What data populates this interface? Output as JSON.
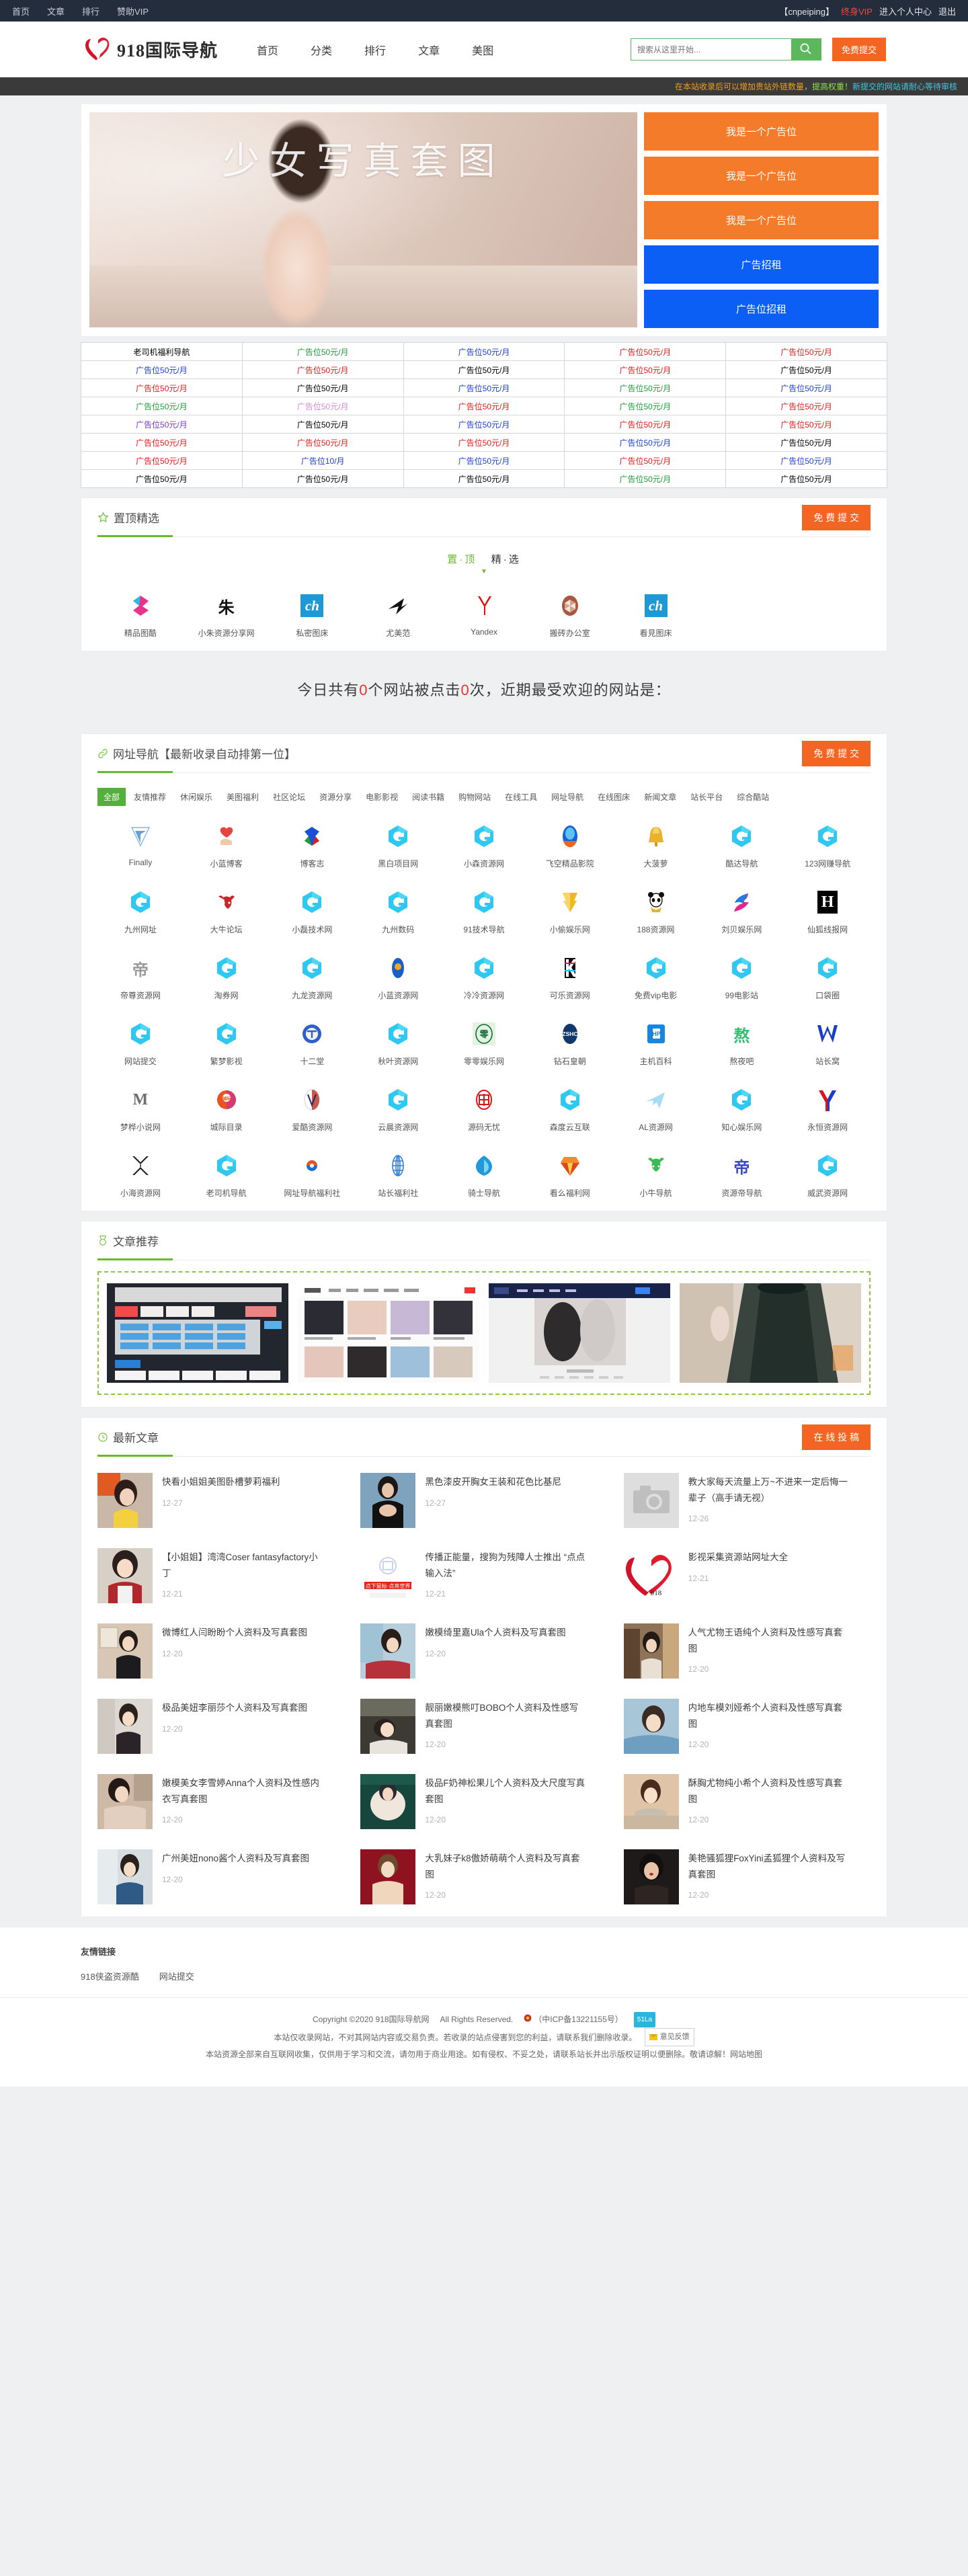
{
  "topbar": {
    "left_links": [
      "首页",
      "文章",
      "排行",
      "赞助VIP"
    ],
    "username": "【cnpeiping】",
    "vip_label": "终身VIP",
    "center_label": "进入个人中心",
    "logout_label": "退出"
  },
  "header": {
    "logo_text": "918国际导航",
    "nav": [
      "首页",
      "分类",
      "排行",
      "文章",
      "美图"
    ],
    "search_placeholder": "搜索从这里开始...",
    "search_value": "",
    "search_icon": "search-icon",
    "submit_label": "免费提交"
  },
  "notice": {
    "part1": "在本站收录后可以增加贵站外链数量",
    "part2": "，提高权重！",
    "part3": "新提交的网站请耐心等待审核"
  },
  "hero": {
    "overlay_text": "少女写真套图",
    "ads": [
      {
        "label": "我是一个广告位",
        "color": "#f47b2a"
      },
      {
        "label": "我是一个广告位",
        "color": "#f47b2a"
      },
      {
        "label": "我是一个广告位",
        "color": "#f47b2a"
      },
      {
        "label": "广告招租",
        "color": "#0b5ff5"
      },
      {
        "label": "广告位招租",
        "color": "#0b5ff5"
      }
    ]
  },
  "ad_table": {
    "rows": [
      [
        {
          "t": "老司机福利导航",
          "c": "#000000"
        },
        {
          "t": "广告位50元/月",
          "c": "#1f9d3a"
        },
        {
          "t": "广告位50元/月",
          "c": "#1b3fd4"
        },
        {
          "t": "广告位50元/月",
          "c": "#e21b1b"
        },
        {
          "t": "广告位50元/月",
          "c": "#e21b1b"
        }
      ],
      [
        {
          "t": "广告位50元/月",
          "c": "#1b3fd4"
        },
        {
          "t": "广告位50元/月",
          "c": "#e21b1b"
        },
        {
          "t": "广告位50元/月",
          "c": "#000000"
        },
        {
          "t": "广告位50元/月",
          "c": "#e21b1b"
        },
        {
          "t": "广告位50元/月",
          "c": "#000000"
        }
      ],
      [
        {
          "t": "广告位50元/月",
          "c": "#e21b1b"
        },
        {
          "t": "广告位50元/月",
          "c": "#000000"
        },
        {
          "t": "广告位50元/月",
          "c": "#1b3fd4"
        },
        {
          "t": "广告位50元/月",
          "c": "#1f9d3a"
        },
        {
          "t": "广告位50元/月",
          "c": "#1b3fd4"
        }
      ],
      [
        {
          "t": "广告位50元/月",
          "c": "#1f9d3a"
        },
        {
          "t": "广告位50元/月",
          "c": "#d58ad5"
        },
        {
          "t": "广告位50元/月",
          "c": "#e21b1b"
        },
        {
          "t": "广告位50元/月",
          "c": "#1f9d3a"
        },
        {
          "t": "广告位50元/月",
          "c": "#e21b1b"
        }
      ],
      [
        {
          "t": "广告位50元/月",
          "c": "#7a36c9"
        },
        {
          "t": "广告位50元/月",
          "c": "#000000"
        },
        {
          "t": "广告位50元/月",
          "c": "#1b3fd4"
        },
        {
          "t": "广告位50元/月",
          "c": "#e21b1b"
        },
        {
          "t": "广告位50元/月",
          "c": "#e21b1b"
        }
      ],
      [
        {
          "t": "广告位50元/月",
          "c": "#e21b1b"
        },
        {
          "t": "广告位50元/月",
          "c": "#e21b1b"
        },
        {
          "t": "广告位50元/月",
          "c": "#e21b1b"
        },
        {
          "t": "广告位50元/月",
          "c": "#1b3fd4"
        },
        {
          "t": "广告位50元/月",
          "c": "#000000"
        }
      ],
      [
        {
          "t": "广告位50元/月",
          "c": "#e21b1b"
        },
        {
          "t": "广告位10/月",
          "c": "#1b3fd4"
        },
        {
          "t": "广告位50元/月",
          "c": "#1b3fd4"
        },
        {
          "t": "广告位50元/月",
          "c": "#e21b1b"
        },
        {
          "t": "广告位50元/月",
          "c": "#1b3fd4"
        }
      ],
      [
        {
          "t": "广告位50元/月",
          "c": "#000000"
        },
        {
          "t": "广告位50元/月",
          "c": "#000000"
        },
        {
          "t": "广告位50元/月",
          "c": "#000000"
        },
        {
          "t": "广告位50元/月",
          "c": "#1f9d3a"
        },
        {
          "t": "广告位50元/月",
          "c": "#000000"
        }
      ]
    ]
  },
  "top_selection": {
    "title": "置顶精选",
    "icon": "star-icon",
    "submit_label": "免 费 提 交",
    "divider_top": "置·顶",
    "divider_fine": "精·选",
    "items": [
      {
        "name": "精品图酷",
        "logo": "pink-s-icon"
      },
      {
        "name": "小朱资源分享网",
        "logo": "zhu-char-icon"
      },
      {
        "name": "私密图床",
        "logo": "ch-blue-icon"
      },
      {
        "name": "尤美范",
        "logo": "black-swoosh-icon"
      },
      {
        "name": "Yandex",
        "logo": "yandex-y-icon"
      },
      {
        "name": "搬砖办公室",
        "logo": "brown-cube-icon"
      },
      {
        "name": "看見图床",
        "logo": "ch-blue-icon"
      }
    ]
  },
  "stats": {
    "prefix": "今日共有",
    "site_count": "0",
    "middle": "个网站被点击",
    "click_count": "0",
    "suffix": "次，近期最受欢迎的网站是："
  },
  "nav_section": {
    "title": "网址导航【最新收录自动排第一位】",
    "icon": "link-icon",
    "submit_label": "免 费 提 交",
    "categories": [
      "全部",
      "友情推荐",
      "休闲娱乐",
      "美图福利",
      "社区论坛",
      "资源分享",
      "电影影视",
      "阅读书籍",
      "购物网站",
      "在线工具",
      "网址导航",
      "在线图床",
      "新闻文章",
      "站长平台",
      "综合酷站"
    ],
    "active_category": "全部",
    "sites": [
      {
        "name": "Finally",
        "logo": "triangle-f-icon"
      },
      {
        "name": "小蓝博客",
        "logo": "heart-hand-icon"
      },
      {
        "name": "博客志",
        "logo": "multicolor-s-icon"
      },
      {
        "name": "黑白项目网",
        "logo": "g-cyan-icon"
      },
      {
        "name": "小森资源网",
        "logo": "g-cyan-icon"
      },
      {
        "name": "飞空精品影院",
        "logo": "blue-orb-icon"
      },
      {
        "name": "大菠萝",
        "logo": "gold-bell-icon"
      },
      {
        "name": "酷达导航",
        "logo": "g-cyan-icon"
      },
      {
        "name": "123网赚导航",
        "logo": "g-cyan-icon"
      },
      {
        "name": "九州网址",
        "logo": "g-cyan-icon"
      },
      {
        "name": "大牛论坛",
        "logo": "red-bull-icon"
      },
      {
        "name": "小磊技术网",
        "logo": "g-cyan-icon"
      },
      {
        "name": "九州数码",
        "logo": "g-cyan-icon"
      },
      {
        "name": "91技术导航",
        "logo": "g-cyan-icon"
      },
      {
        "name": "小偷娱乐网",
        "logo": "gold-arrow-icon"
      },
      {
        "name": "188资源网",
        "logo": "panda-icon"
      },
      {
        "name": "刘贝娱乐网",
        "logo": "pink-swirl-icon"
      },
      {
        "name": "仙狐线报网",
        "logo": "black-h-icon"
      },
      {
        "name": "帝尊资源网",
        "logo": "di-char-icon"
      },
      {
        "name": "淘券网",
        "logo": "g-cyan-icon"
      },
      {
        "name": "九龙资源网",
        "logo": "g-cyan-icon"
      },
      {
        "name": "小蓝资源网",
        "logo": "blue-dot-icon"
      },
      {
        "name": "冷冷资源网",
        "logo": "g-cyan-icon"
      },
      {
        "name": "可乐资源网",
        "logo": "k-glitch-icon"
      },
      {
        "name": "免费vip电影",
        "logo": "g-cyan-icon"
      },
      {
        "name": "99电影站",
        "logo": "g-cyan-icon"
      },
      {
        "name": "口袋圈",
        "logo": "g-cyan-icon"
      },
      {
        "name": "网站提交",
        "logo": "g-cyan-icon"
      },
      {
        "name": "繁梦影视",
        "logo": "g-cyan-icon"
      },
      {
        "name": "十二堂",
        "logo": "blue-circle-t-icon"
      },
      {
        "name": "秋叶资源网",
        "logo": "g-cyan-icon"
      },
      {
        "name": "零零娱乐网",
        "logo": "ling-circle-icon"
      },
      {
        "name": "钻石皇朝",
        "logo": "zshc-oval-icon"
      },
      {
        "name": "主机百科",
        "logo": "blue-square-icon"
      },
      {
        "name": "熬夜吧",
        "logo": "ao-green-icon"
      },
      {
        "name": "站长窝",
        "logo": "blue-w-icon"
      },
      {
        "name": "梦桦小说网",
        "logo": "m-serif-icon"
      },
      {
        "name": "城际目录",
        "logo": "orange-circle-icon"
      },
      {
        "name": "爱酷资源网",
        "logo": "v-oval-icon"
      },
      {
        "name": "云晨资源网",
        "logo": "g-cyan-icon"
      },
      {
        "name": "源码无忧",
        "logo": "red-oval-icon"
      },
      {
        "name": "森度云互联",
        "logo": "g-cyan-icon"
      },
      {
        "name": "AL资源网",
        "logo": "plane-icon"
      },
      {
        "name": "知心娱乐网",
        "logo": "g-cyan-icon"
      },
      {
        "name": "永恒资源网",
        "logo": "red-blue-y-icon"
      },
      {
        "name": "小海资源网",
        "logo": "x-outline-icon"
      },
      {
        "name": "老司机导航",
        "logo": "g-cyan-icon"
      },
      {
        "name": "网址导航福利社",
        "logo": "small-orb-icon"
      },
      {
        "name": "站长福利社",
        "logo": "globe-blue-icon"
      },
      {
        "name": "骑士导航",
        "logo": "blue-leaf-icon"
      },
      {
        "name": "看么福利网",
        "logo": "red-diamond-icon"
      },
      {
        "name": "小牛导航",
        "logo": "green-bull-icon"
      },
      {
        "name": "资源帝导航",
        "logo": "di-blue-icon"
      },
      {
        "name": "威武资源网",
        "logo": "g-cyan-icon"
      }
    ]
  },
  "article_rec": {
    "title": "文章推荐",
    "icon": "medal-icon",
    "thumbs": [
      "rec-thumb-1",
      "rec-thumb-2",
      "rec-thumb-3",
      "rec-thumb-4"
    ]
  },
  "latest": {
    "title": "最新文章",
    "icon": "clock-icon",
    "submit_label": "在 线 投 稿",
    "articles": [
      {
        "title": "快看小姐姐美图卧槽萝莉福利",
        "date": "12-27",
        "thumb": "girl-yellow-top"
      },
      {
        "title": "黑色漆皮开胸女王装和花色比基尼",
        "date": "12-27",
        "thumb": "girl-black-latex"
      },
      {
        "title": "教大家每天流量上万~不进来一定后悔一辈子（高手请无视）",
        "date": "12-26",
        "thumb": "camera-placeholder"
      },
      {
        "title": "【小姐姐】湾湾Coser fantasyfactory小丁",
        "date": "12-21",
        "thumb": "coser-girl"
      },
      {
        "title": "传播正能量，搜狗为残障人士推出 “点点输入法”",
        "date": "12-21",
        "thumb": "sogou-banner"
      },
      {
        "title": "影视采集资源站网址大全",
        "date": "12-21",
        "thumb": "site-logo"
      },
      {
        "title": "微博红人闫盼盼个人资料及写真套图",
        "date": "12-20",
        "thumb": "yanpanpan"
      },
      {
        "title": "嫩模绮里嘉Ula个人资料及写真套图",
        "date": "12-20",
        "thumb": "qilijia"
      },
      {
        "title": "人气尤物王语纯个人资料及性感写真套图",
        "date": "12-20",
        "thumb": "wangyuchun"
      },
      {
        "title": "极品美妞李丽莎个人资料及写真套图",
        "date": "12-20",
        "thumb": "lilisha"
      },
      {
        "title": "靓丽嫩模熊叮BOBO个人资料及性感写真套图",
        "date": "12-20",
        "thumb": "bobo"
      },
      {
        "title": "内地车模刘娅希个人资料及性感写真套图",
        "date": "12-20",
        "thumb": "liuyaxi"
      },
      {
        "title": "嫩模美女李雪婷Anna个人资料及性感内衣写真套图",
        "date": "12-20",
        "thumb": "lixueting"
      },
      {
        "title": "极品F奶神松果儿个人资料及大尺度写真套图",
        "date": "12-20",
        "thumb": "songguoer"
      },
      {
        "title": "酥胸尤物纯小希个人资料及性感写真套图",
        "date": "12-20",
        "thumb": "chunxiaoxi"
      },
      {
        "title": "广州美妞nono酱个人资料及写真套图",
        "date": "12-20",
        "thumb": "nono"
      },
      {
        "title": "大乳妹子k8傲娇萌萌个人资料及写真套图",
        "date": "12-20",
        "thumb": "k8mengmeng"
      },
      {
        "title": "美艳骚狐狸FoxYini孟狐狸个人资料及写真套图",
        "date": "12-20",
        "thumb": "foxyini"
      }
    ]
  },
  "friend_links": {
    "title": "友情链接",
    "links": [
      "918侠盗资源酷",
      "网站提交"
    ]
  },
  "footer": {
    "copyright": "Copyright ©2020 918国际导航网",
    "rights": "All Rights Reserved.",
    "icp": "（中ICP备13221155号）",
    "la_badge": "51La",
    "line2": "本站仅收录网站，不对其网站内容或交易负责。若收录的站点侵害到您的利益，请联系我们删除收录。",
    "feedback_label": "意见反馈",
    "line3": "本站资源全部来自互联网收集，仅供用于学习和交流，请勿用于商业用途。如有侵权、不妥之处，请联系站长并出示版权证明以便删除。敬请谅解！",
    "sitemap": "网站地图"
  },
  "colors": {
    "accent_green": "#68b92e",
    "accent_orange": "#f26522",
    "topbar_bg": "#242d3b",
    "ad_orange": "#f47b2a",
    "ad_blue": "#0b5ff5"
  }
}
